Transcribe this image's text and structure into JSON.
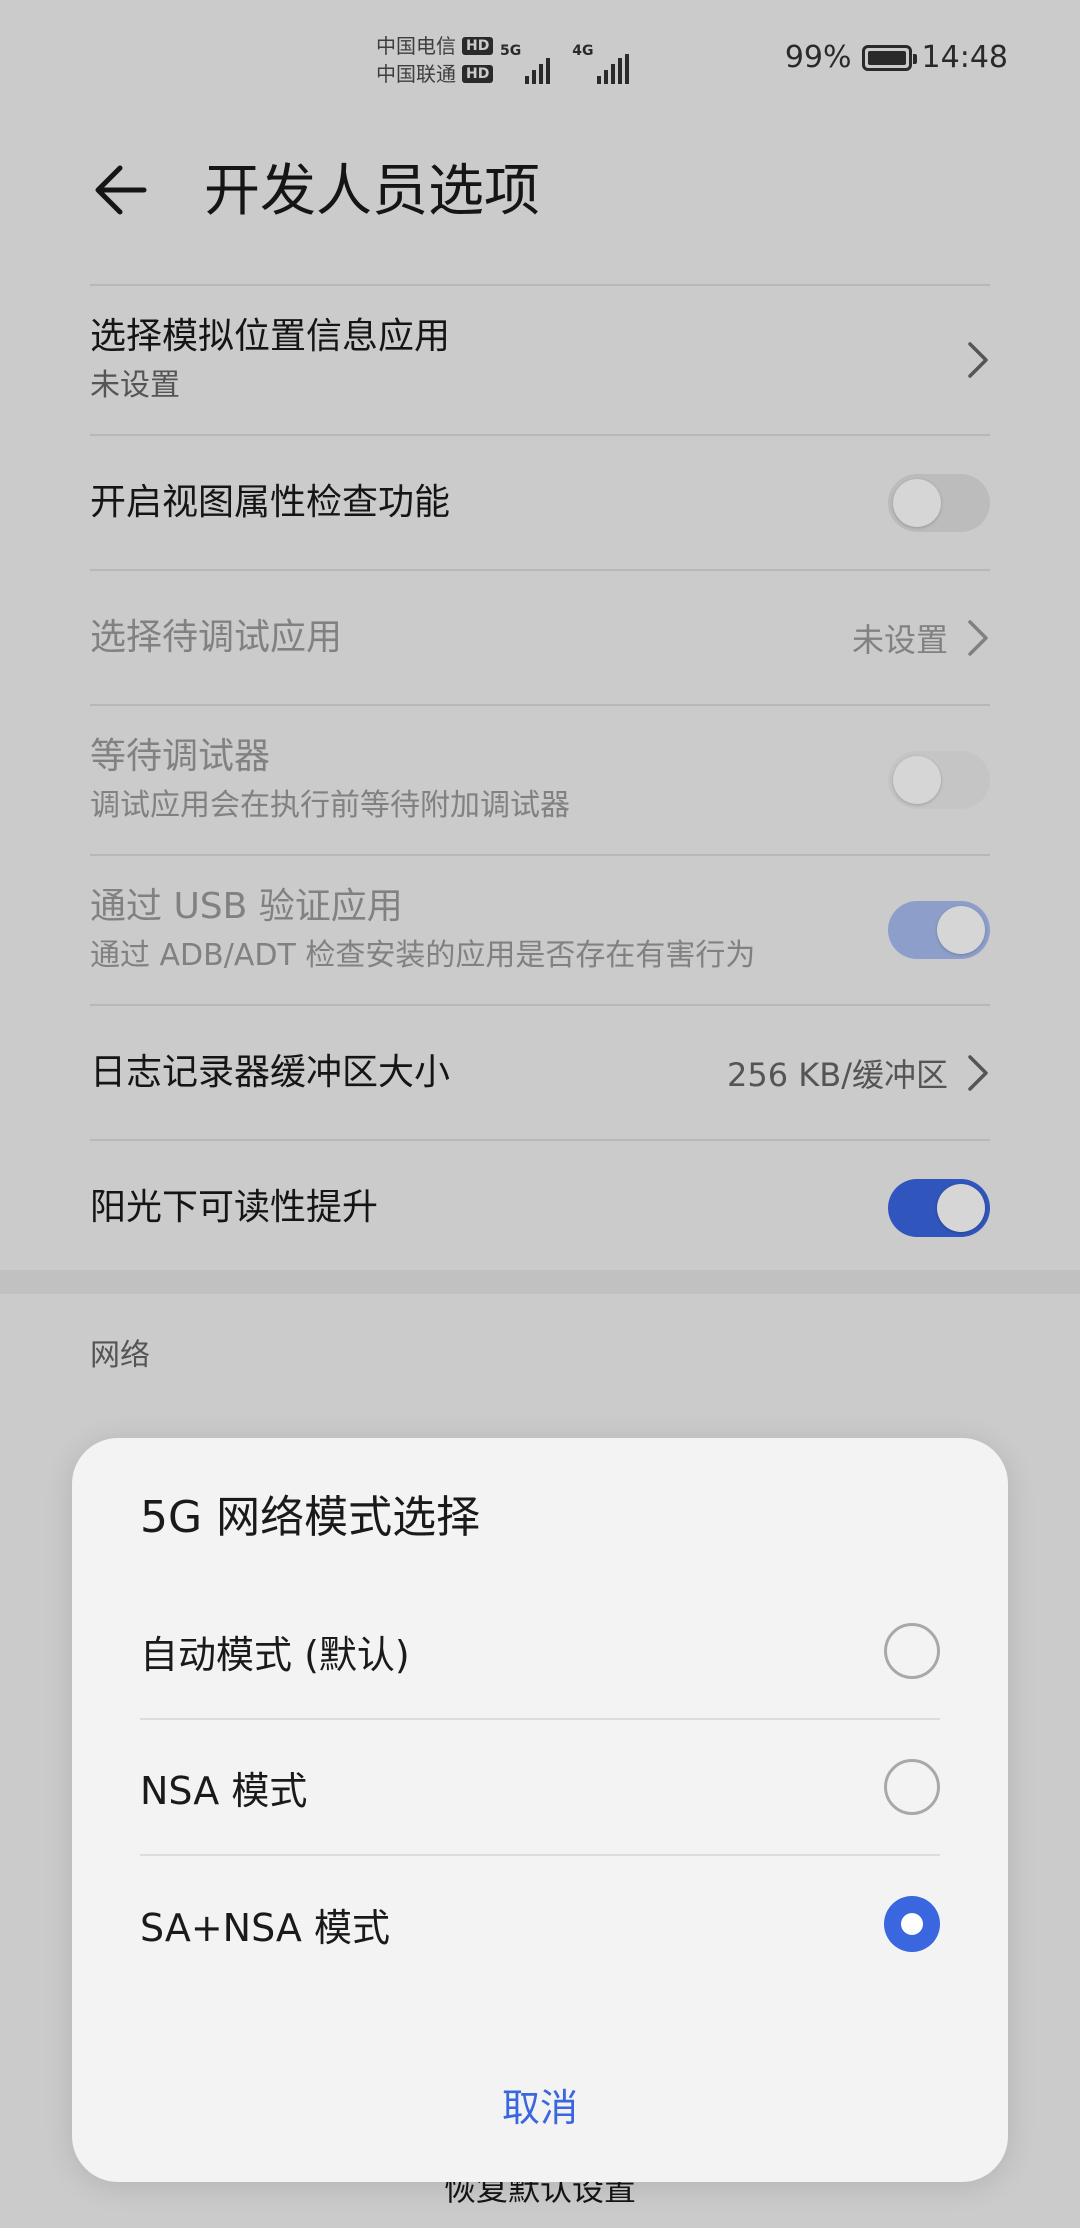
{
  "status_bar": {
    "carrier1": "中国电信",
    "carrier2": "中国联通",
    "hd": "HD",
    "net1": "5G",
    "net2": "4G",
    "battery": "99%",
    "time": "14:48"
  },
  "header": {
    "title": "开发人员选项"
  },
  "settings": {
    "mock_location": {
      "title": "选择模拟位置信息应用",
      "sub": "未设置"
    },
    "view_attr": {
      "title": "开启视图属性检查功能",
      "toggle": "off"
    },
    "debug_app": {
      "title": "选择待调试应用",
      "value": "未设置"
    },
    "wait_debugger": {
      "title": "等待调试器",
      "sub": "调试应用会在执行前等待附加调试器",
      "toggle": "off"
    },
    "usb_verify": {
      "title": "通过 USB 验证应用",
      "sub": "通过 ADB/ADT 检查安装的应用是否存在有害行为",
      "toggle": "on"
    },
    "log_buffer": {
      "title": "日志记录器缓冲区大小",
      "value": "256 KB/缓冲区"
    },
    "sunlight": {
      "title": "阳光下可读性提升",
      "toggle": "on"
    }
  },
  "section": {
    "network": "网络"
  },
  "restore": "恢复默认设置",
  "dialog": {
    "title": "5G 网络模式选择",
    "options": [
      {
        "label": "自动模式 (默认)",
        "selected": false
      },
      {
        "label": "NSA 模式",
        "selected": false
      },
      {
        "label": "SA+NSA 模式",
        "selected": true
      }
    ],
    "cancel": "取消"
  },
  "colors": {
    "accent": "#3a66e0",
    "accent_dim": "#a9bdf1"
  }
}
